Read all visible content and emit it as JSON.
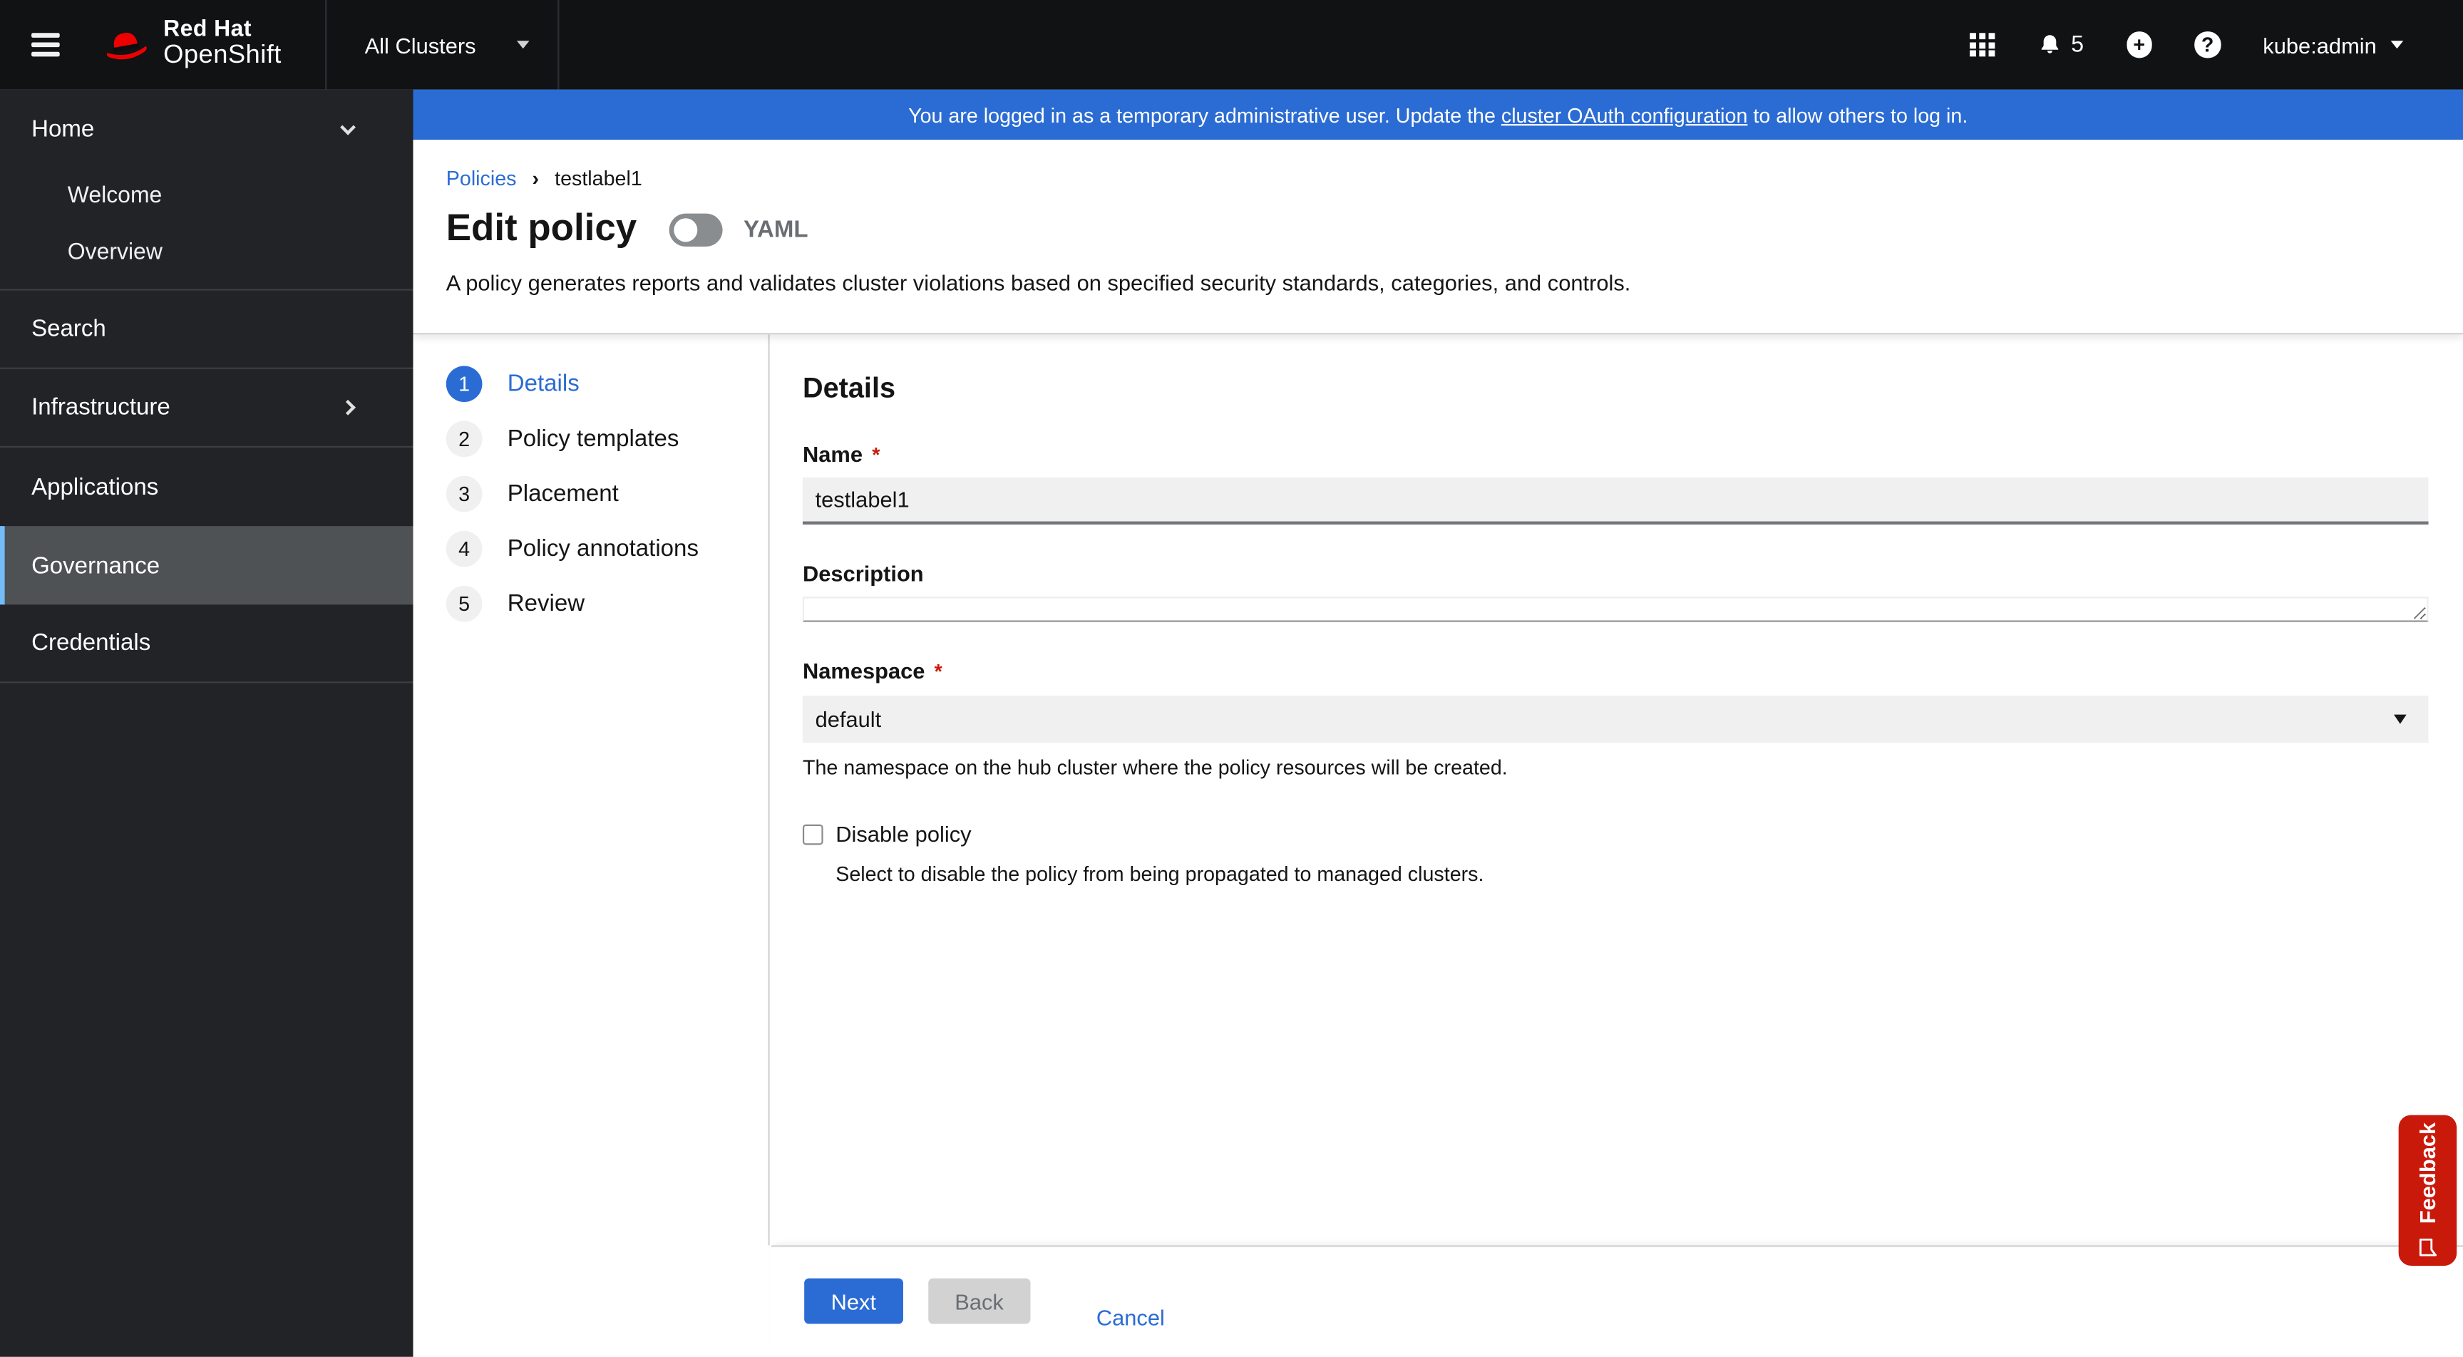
{
  "colors": {
    "accent_blue": "#2b6cd4",
    "banner_blue": "#2b6cd4",
    "danger_red": "#c9190b",
    "masthead_bg": "#101214",
    "sidebar_bg": "#212327",
    "sidebar_active_bg": "#4f5255",
    "sidebar_active_border": "#73bcf7",
    "input_bg": "#f0f0f0"
  },
  "glyphs": {
    "breadcrumb_separator": "›",
    "required_asterisk": "*",
    "plus": "+",
    "question": "?"
  },
  "masthead": {
    "brand_line1": "Red Hat",
    "brand_line2": "OpenShift",
    "cluster_selector": "All Clusters",
    "notification_count": "5",
    "user": "kube:admin"
  },
  "banner": {
    "text_before": "You are logged in as a temporary administrative user. Update the ",
    "link_text": "cluster OAuth configuration",
    "text_after": " to allow others to log in."
  },
  "sidebar": {
    "items": [
      {
        "label": "Home",
        "expanded": true
      },
      {
        "label": "Welcome"
      },
      {
        "label": "Overview"
      },
      {
        "label": "Search"
      },
      {
        "label": "Infrastructure",
        "expandable": true
      },
      {
        "label": "Applications"
      },
      {
        "label": "Governance",
        "active": true
      },
      {
        "label": "Credentials"
      }
    ]
  },
  "breadcrumb": {
    "items": [
      "Policies",
      "testlabel1"
    ]
  },
  "page": {
    "title": "Edit policy",
    "yaml_toggle_label": "YAML",
    "yaml_toggle_on": false,
    "description": "A policy generates reports and validates cluster violations based on specified security standards, categories, and controls."
  },
  "wizard": {
    "steps": [
      {
        "num": "1",
        "label": "Details",
        "active": true
      },
      {
        "num": "2",
        "label": "Policy templates",
        "active": false
      },
      {
        "num": "3",
        "label": "Placement",
        "active": false
      },
      {
        "num": "4",
        "label": "Policy annotations",
        "active": false
      },
      {
        "num": "5",
        "label": "Review",
        "active": false
      }
    ]
  },
  "form": {
    "section_title": "Details",
    "name": {
      "label": "Name",
      "required": true,
      "value": "testlabel1"
    },
    "description": {
      "label": "Description",
      "value": ""
    },
    "namespace": {
      "label": "Namespace",
      "required": true,
      "value": "default",
      "helper": "The namespace on the hub cluster where the policy resources will be created."
    },
    "disable": {
      "label": "Disable policy",
      "checked": false,
      "helper": "Select to disable the policy from being propagated to managed clusters."
    }
  },
  "footer": {
    "next": "Next",
    "back": "Back",
    "cancel": "Cancel"
  },
  "feedback": {
    "label": "Feedback"
  }
}
